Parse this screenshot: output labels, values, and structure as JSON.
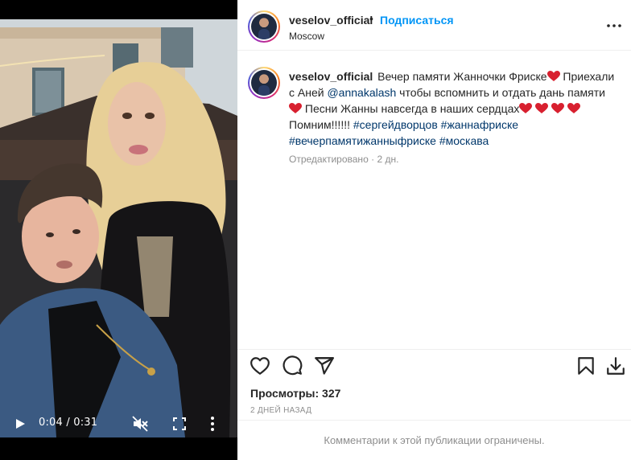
{
  "video": {
    "time_current": "0:04",
    "time_total": "0:31",
    "time_display": "0:04 / 0:31",
    "progress_fraction": 0.13,
    "buffered_fraction": 0.77,
    "muted": true,
    "icons": {
      "play": "play-icon",
      "mute": "volume-muted-icon",
      "fullscreen": "fullscreen-icon",
      "menu": "more-vertical-icon"
    }
  },
  "header": {
    "username": "veselov_official",
    "separator": "•",
    "follow_label": "Подписаться",
    "location": "Moscow",
    "more_icon": "more-horizontal-icon"
  },
  "caption": {
    "username": "veselov_official",
    "parts": {
      "p1": "Вечер памяти Жанночки Фриске",
      "p2": " Приехали с Аней ",
      "mention": "@annakalash",
      "p3": " чтобы вспомнить и отдать дань памяти ",
      "p4": " Песни Жанны навсегда в наших сердцах",
      "p5": " Помним!!!!!! ",
      "tag1": "#сергейдворцов",
      "tag2": "#жаннафриске",
      "tag3": "#вечерпамятижанныфриске",
      "tag4": "#москава"
    },
    "edited_label": "Отредактировано",
    "dot": "·",
    "age": "2 дн."
  },
  "actions": {
    "icons": [
      "heart-icon",
      "comment-icon",
      "share-icon",
      "bookmark-icon",
      "download-icon"
    ]
  },
  "stats": {
    "views_label": "Просмотры: 327",
    "date_label": "2 ДНЕЙ НАЗАД"
  },
  "footer": {
    "comments_disabled": "Комментарии к этой публикации ограничены."
  },
  "colors": {
    "accent": "#0095f6",
    "link": "#00376b",
    "muted_text": "#8e8e8e",
    "heart": "#ed4956"
  }
}
